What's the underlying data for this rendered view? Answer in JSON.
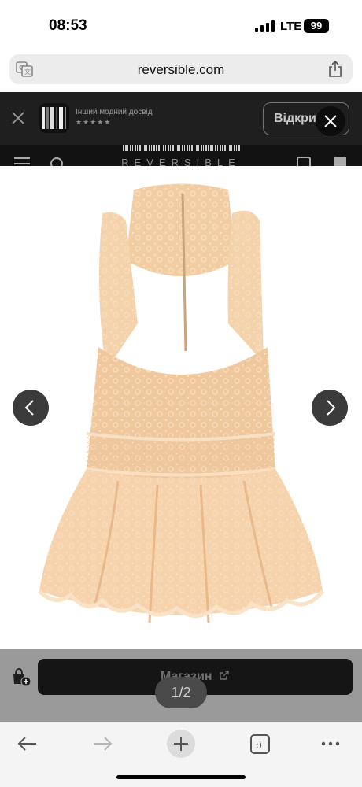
{
  "status_bar": {
    "time": "08:53",
    "network": "LTE",
    "battery": "99"
  },
  "browser": {
    "url": "reversible.com"
  },
  "app_banner": {
    "subtitle": "Інший модний досвід",
    "rating_stars": "★★★★★",
    "open_label": "Відкрити"
  },
  "site": {
    "brand": "REVERSIBLE"
  },
  "gallery": {
    "page_indicator": "1/2"
  },
  "buy_bar": {
    "shop_label": "Магазин"
  },
  "colors": {
    "banner_bg": "#1f1f1f",
    "dress": "#f2cda3",
    "dress_lace": "#fbe3c4",
    "overlay_gray": "#9a9a9a"
  }
}
